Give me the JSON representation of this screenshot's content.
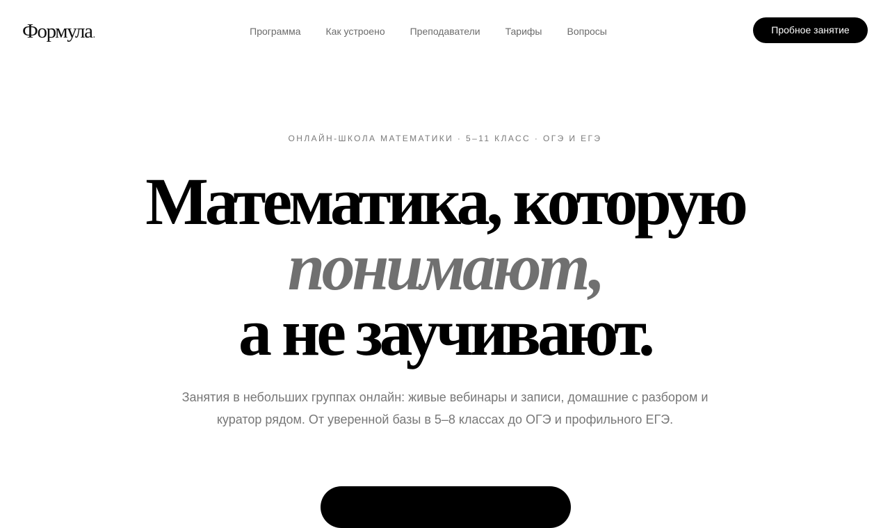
{
  "header": {
    "logo_text": "Формула",
    "logo_dot": ".",
    "nav": [
      {
        "label": "Программа"
      },
      {
        "label": "Как устроено"
      },
      {
        "label": "Преподаватели"
      },
      {
        "label": "Тарифы"
      },
      {
        "label": "Вопросы"
      }
    ],
    "cta_label": "Пробное занятие"
  },
  "hero": {
    "eyebrow": "ОНЛАЙН-ШКОЛА МАТЕМАТИКИ · 5–11 КЛАСС · ОГЭ И ЕГЭ",
    "headline_line1": "Математика, которую",
    "headline_line2": "понимают,",
    "headline_line3": "а не заучивают.",
    "lead": "Занятия в небольших группах онлайн: живые вебинары и записи, домашние с разбором и куратор рядом. От уверенной базы в 5–8 классах до ОГЭ и профильного ЕГЭ."
  },
  "colors": {
    "accent": "#000000",
    "background": "#ffffff",
    "muted_text": "#777777",
    "headline_italic": "#707070"
  }
}
